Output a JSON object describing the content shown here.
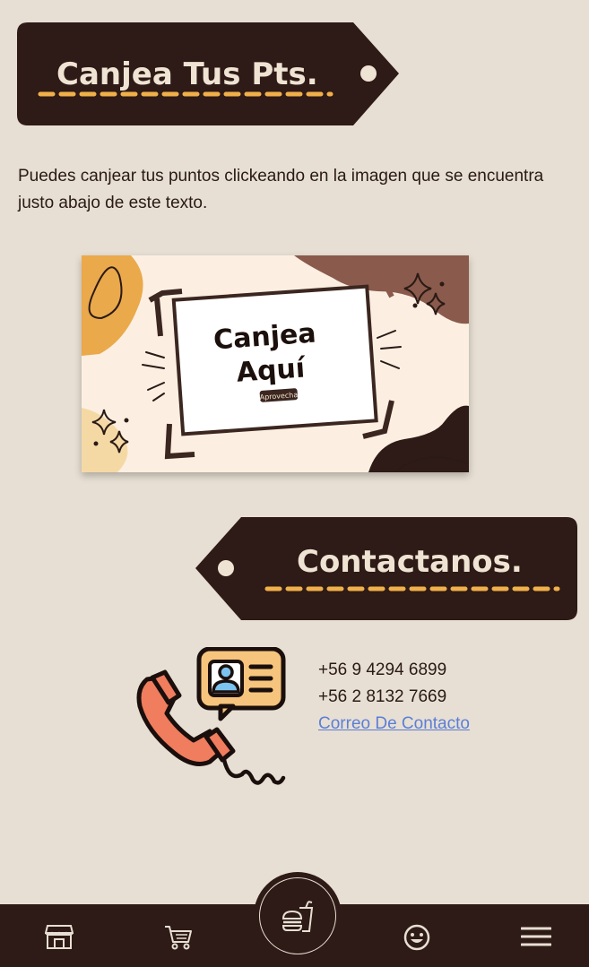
{
  "sections": {
    "redeem": {
      "title": "Canjea Tus Pts.",
      "description": "Puedes canjear tus puntos clickeando en la imagen que se encuentra justo abajo de este texto.",
      "banner": {
        "line1": "Canjea",
        "line2": "Aquí",
        "badge": "Aprovecha"
      }
    },
    "contact": {
      "title": "Contactanos.",
      "phone1": "+56 9 4294 6899",
      "phone2": "+56 2 8132 7669",
      "email_link": "Correo De Contacto"
    }
  },
  "bottom_nav": {
    "items": [
      "store-icon",
      "cart-icon",
      "burger-drink-icon",
      "smiley-icon",
      "menu-icon"
    ]
  },
  "colors": {
    "background": "#e7dfd3",
    "tag": "#2e1a16",
    "tag_text": "#efe4d3",
    "dash_accent": "#f0b04a",
    "link": "#5b7fd6"
  }
}
